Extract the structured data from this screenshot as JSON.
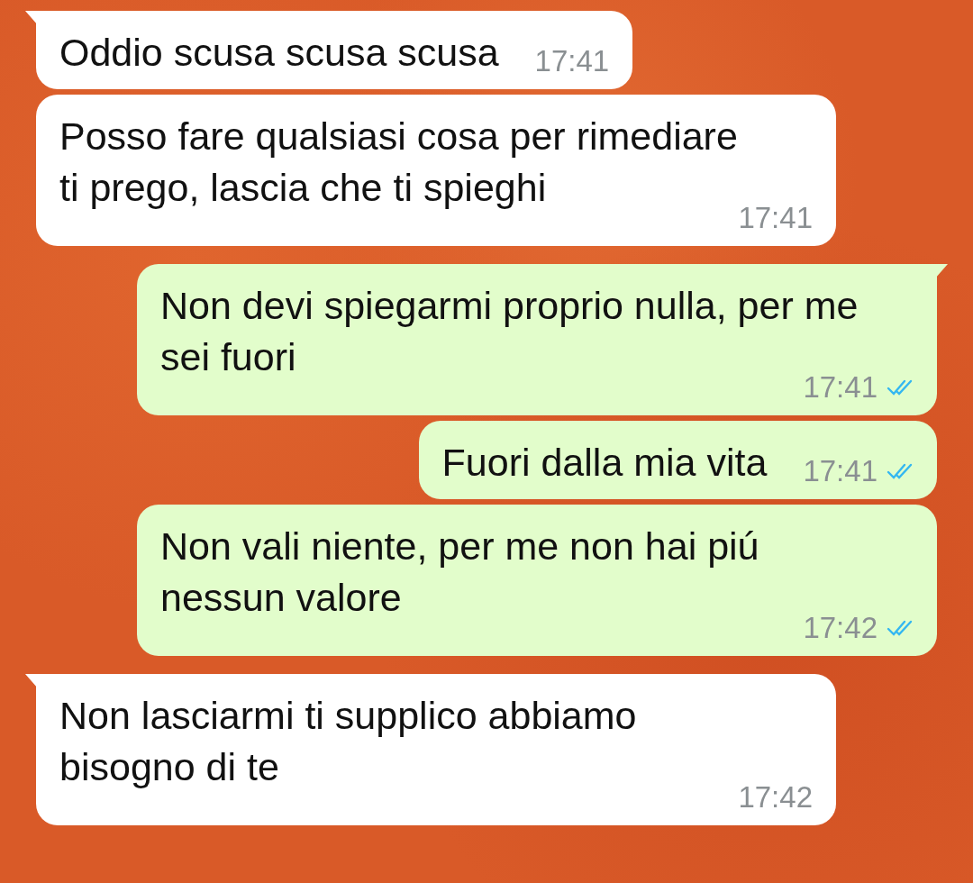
{
  "messages": [
    {
      "kind": "incoming",
      "tail": true,
      "text": "Oddio scusa scusa scusa",
      "time": "17:41"
    },
    {
      "kind": "incoming",
      "tail": false,
      "text": "Posso fare qualsiasi cosa per rimediare ti prego, lascia che ti spieghi",
      "time": "17:41"
    },
    {
      "kind": "outgoing",
      "tail": true,
      "text": "Non devi spiegarmi proprio nulla, per me sei fuori",
      "time": "17:41",
      "read": true
    },
    {
      "kind": "outgoing",
      "tail": false,
      "text": "Fuori dalla mia vita",
      "time": "17:41",
      "read": true
    },
    {
      "kind": "outgoing",
      "tail": false,
      "text": "Non vali niente, per me non hai piú nessun valore",
      "time": "17:42",
      "read": true
    },
    {
      "kind": "incoming",
      "tail": true,
      "text": "Non lasciarmi ti supplico abbiamo bisogno di te",
      "time": "17:42"
    }
  ]
}
